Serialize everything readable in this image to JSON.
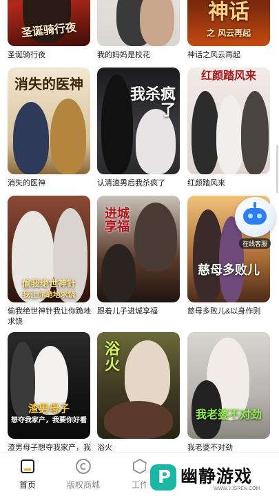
{
  "colors": {
    "accent": "#f5a623",
    "tab_active": "#222222",
    "tab_inactive": "#888888"
  },
  "dramas": [
    {
      "caption": "圣诞骑行夜",
      "poster_text": "圣诞骑行夜"
    },
    {
      "caption": "我的妈妈是校花",
      "poster_text": ""
    },
    {
      "caption": "神话之风云再起",
      "poster_text": "神话"
    },
    {
      "caption": "消失的医神",
      "poster_text": "消失的医神"
    },
    {
      "caption": "认清渣男后我杀疯了",
      "poster_text": "我杀疯了"
    },
    {
      "caption": "红颜踏风来",
      "poster_text": "红颜踏风来"
    },
    {
      "caption": "偷我绝世神针我让你跪地求饶",
      "poster_text": "偷我绝世神针"
    },
    {
      "caption": "跟着儿子进城享福",
      "poster_text": "进城享福"
    },
    {
      "caption": "慈母多败儿&以身作则",
      "poster_text": "慈母多败儿"
    },
    {
      "caption": "渣男母子想夺我家产，我",
      "poster_text": "渣男母子"
    },
    {
      "caption": "浴火",
      "poster_text": "浴火"
    },
    {
      "caption": "我老婆不对劲",
      "poster_text": "我老婆不对劲"
    }
  ],
  "customer_service": {
    "label": "在线客服",
    "icon": "robot-icon"
  },
  "tabs": [
    {
      "label": "首页",
      "icon": "home-icon",
      "active": true
    },
    {
      "label": "版权商城",
      "icon": "copyright-icon",
      "active": false
    },
    {
      "label": "工作",
      "icon": "work-icon",
      "active": false
    }
  ],
  "watermark": {
    "logo_char": "P",
    "text": "幽静游戏",
    "url": "WWW.YJSREN.COM"
  }
}
